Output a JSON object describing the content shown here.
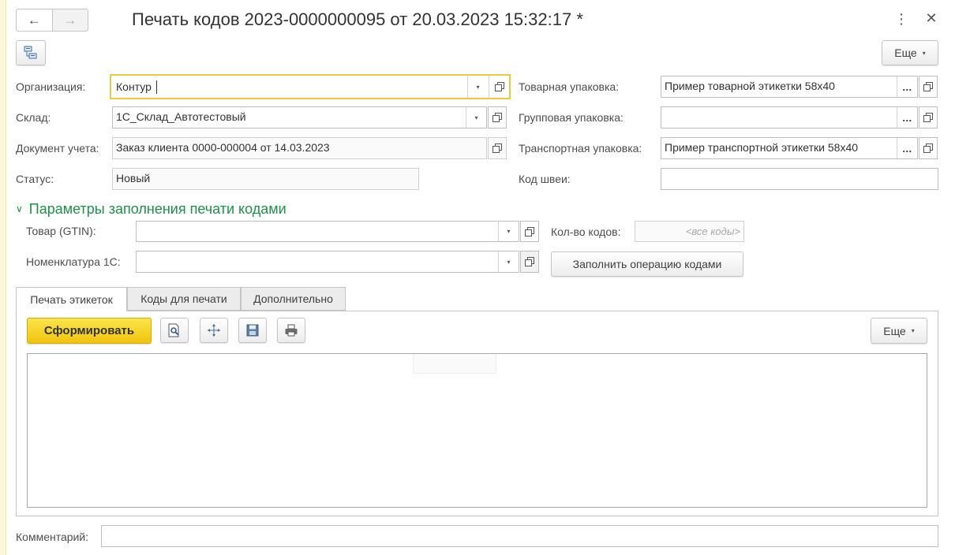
{
  "window": {
    "title": "Печать кодов 2023-0000000095 от 20.03.2023 15:32:17 *"
  },
  "icons": {
    "back": "←",
    "forward": "→",
    "more": "⋮",
    "close": "✕",
    "dropdown": "▾",
    "select": "...",
    "collapse": "∨"
  },
  "toolbar": {
    "more_label": "Еще"
  },
  "fields": {
    "organization": {
      "label": "Организация:",
      "value": "Контур"
    },
    "warehouse": {
      "label": "Склад:",
      "value": "1С_Склад_Автотестовый"
    },
    "document": {
      "label": "Документ учета:",
      "value": "Заказ клиента 0000-000004 от 14.03.2023"
    },
    "status": {
      "label": "Статус:",
      "value": "Новый"
    },
    "product_pack": {
      "label": "Товарная упаковка:",
      "value": "Пример товарной этикетки 58x40"
    },
    "group_pack": {
      "label": "Групповая упаковка:",
      "value": ""
    },
    "transport_pack": {
      "label": "Транспортная упаковка:",
      "value": "Пример транспортной этикетки 58x40"
    },
    "sewing_code": {
      "label": "Код швеи:",
      "value": ""
    },
    "comment": {
      "label": "Комментарий:",
      "value": ""
    }
  },
  "fill_params": {
    "section_title": "Параметры заполнения печати кодами",
    "gtin": {
      "label": "Товар (GTIN):",
      "value": ""
    },
    "nomenclature": {
      "label": "Номенклатура 1С:",
      "value": ""
    },
    "count": {
      "label": "Кол-во кодов:",
      "placeholder": "<все коды>"
    },
    "fill_button": "Заполнить операцию кодами"
  },
  "tabs": [
    {
      "label": "Печать этикеток",
      "active": true
    },
    {
      "label": "Коды для печати",
      "active": false
    },
    {
      "label": "Дополнительно",
      "active": false
    }
  ],
  "print_panel": {
    "generate_button": "Сформировать",
    "more_label": "Еще"
  },
  "colors": {
    "accent_green": "#1c9247",
    "primary_yellow": "#f1c40f",
    "focus_border": "#f0c93a"
  }
}
